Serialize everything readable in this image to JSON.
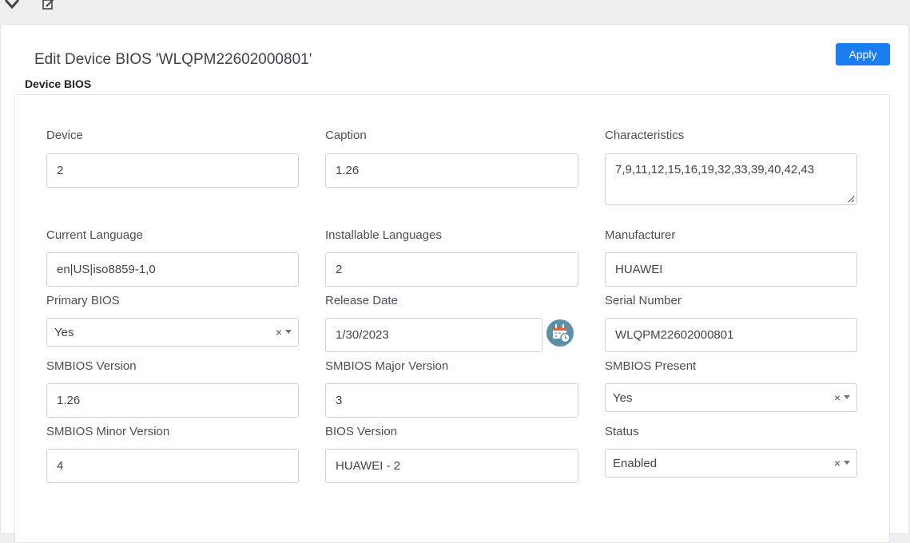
{
  "toolbar": {
    "left_icon": "diamond-check-icon",
    "right_icon": "edit-icon"
  },
  "dialog": {
    "title": "Edit Device BIOS 'WLQPM22602000801'",
    "apply_label": "Apply",
    "section_label": "Device BIOS"
  },
  "fields": {
    "device": {
      "label": "Device",
      "value": "2"
    },
    "caption": {
      "label": "Caption",
      "value": "1.26"
    },
    "characteristics": {
      "label": "Characteristics",
      "value": "7,9,11,12,15,16,19,32,33,39,40,42,43"
    },
    "current_language": {
      "label": "Current Language",
      "value": "en|US|iso8859-1,0"
    },
    "installable_languages": {
      "label": "Installable Languages",
      "value": "2"
    },
    "manufacturer": {
      "label": "Manufacturer",
      "value": "HUAWEI"
    },
    "primary_bios": {
      "label": "Primary BIOS",
      "value": "Yes"
    },
    "release_date": {
      "label": "Release Date",
      "value": "1/30/2023"
    },
    "serial_number": {
      "label": "Serial Number",
      "value": "WLQPM22602000801"
    },
    "smbios_version": {
      "label": "SMBIOS Version",
      "value": "1.26"
    },
    "smbios_major_version": {
      "label": "SMBIOS Major Version",
      "value": "3"
    },
    "smbios_present": {
      "label": "SMBIOS Present",
      "value": "Yes"
    },
    "smbios_minor_version": {
      "label": "SMBIOS Minor Version",
      "value": "4"
    },
    "bios_version": {
      "label": "BIOS Version",
      "value": "HUAWEI - 2"
    },
    "status": {
      "label": "Status",
      "value": "Enabled"
    }
  },
  "select_clear_symbol": "×",
  "colors": {
    "accent": "#1a7ef0",
    "calendar_icon": "#5d8fa8"
  }
}
